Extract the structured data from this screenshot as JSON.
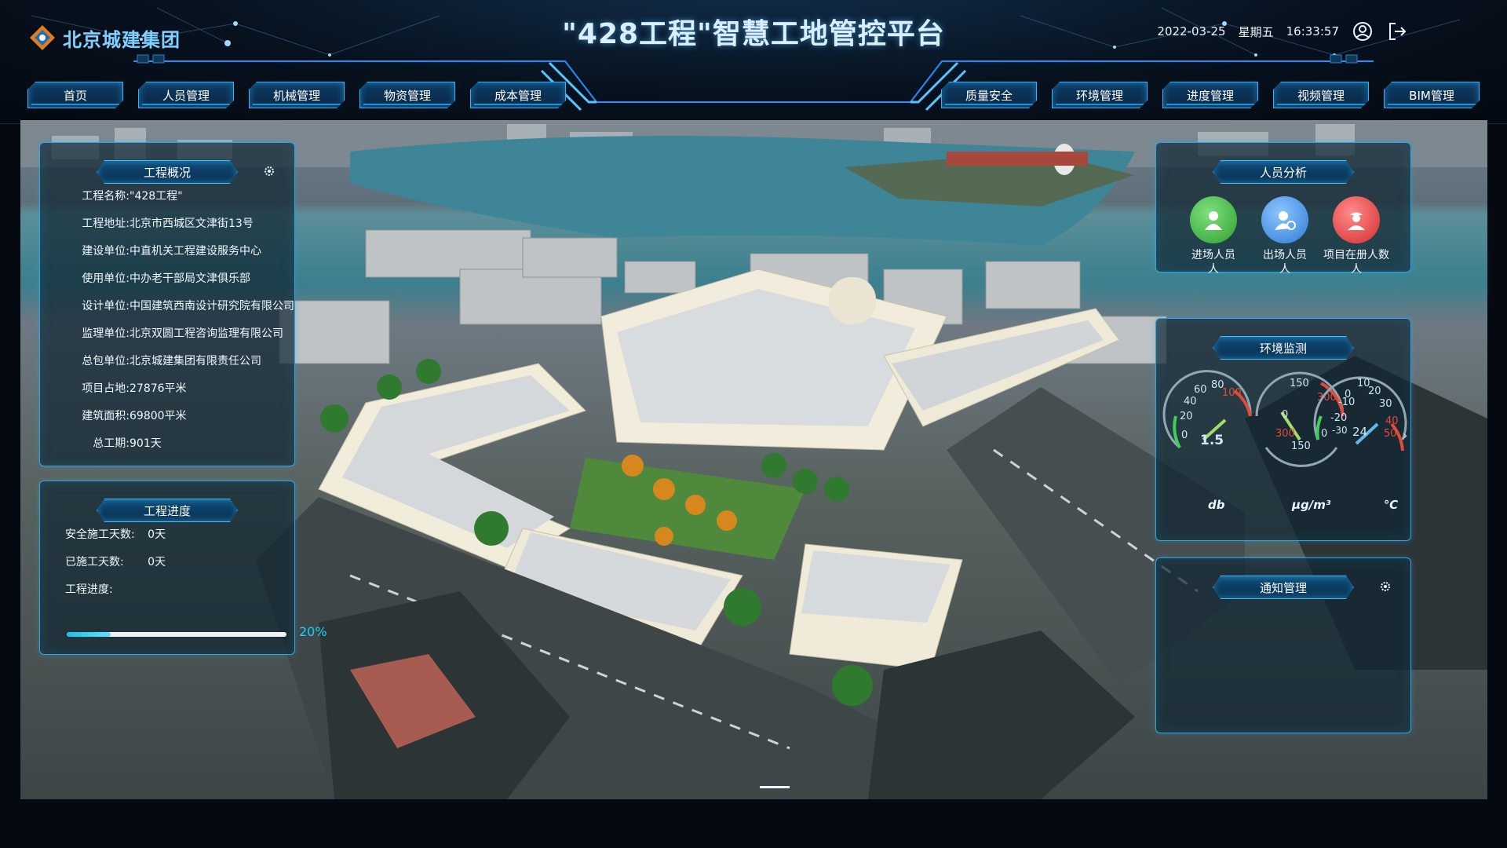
{
  "header": {
    "logo_text": "北京城建集团",
    "title": "\"428工程\"智慧工地管控平台",
    "date": "2022-03-25",
    "weekday": "星期五",
    "time": "16:33:57"
  },
  "nav": {
    "items": [
      "首页",
      "人员管理",
      "机械管理",
      "物资管理",
      "成本管理",
      "质量安全",
      "环境管理",
      "进度管理",
      "视频管理",
      "BIM管理"
    ]
  },
  "overview": {
    "title": "工程概况",
    "rows": [
      {
        "label": "工程名称:",
        "value": "\"428工程\""
      },
      {
        "label": "工程地址:",
        "value": "北京市西城区文津街13号"
      },
      {
        "label": "建设单位:",
        "value": "中直机关工程建设服务中心"
      },
      {
        "label": "使用单位:",
        "value": "中办老干部局文津俱乐部"
      },
      {
        "label": "设计单位:",
        "value": "中国建筑西南设计研究院有限公司"
      },
      {
        "label": "监理单位:",
        "value": "北京双圆工程咨询监理有限公司"
      },
      {
        "label": "总包单位:",
        "value": "北京城建集团有限责任公司"
      },
      {
        "label": "项目占地:",
        "value": "27876平米"
      },
      {
        "label": "建筑面积:",
        "value": "69800平米"
      },
      {
        "label": "总工期:",
        "value": "901天"
      }
    ]
  },
  "progress": {
    "title": "工程进度",
    "safe_days_label": "安全施工天数:",
    "safe_days_value": "0天",
    "done_days_label": "已施工天数:",
    "done_days_value": "0天",
    "progress_label": "工程进度:",
    "percent_text": "20%",
    "percent": 0.2
  },
  "personnel": {
    "title": "人员分析",
    "items": [
      {
        "label": "进场人员",
        "unit": "人",
        "color": "#3fbf3f"
      },
      {
        "label": "出场人员",
        "unit": "人",
        "color": "#3a8fe6"
      },
      {
        "label": "项目在册人数",
        "unit": "人",
        "color": "#e23b3b"
      }
    ]
  },
  "environment": {
    "title": "环境监测",
    "noise": {
      "value_text": "1.5",
      "unit": "db",
      "ticks": [
        "20",
        "40",
        "60",
        "80",
        "100"
      ],
      "zero": "0"
    },
    "pm": {
      "unit": "μg/m³",
      "ticks": [
        "0",
        "150",
        "300"
      ],
      "inner_ticks": [
        "300",
        "150",
        "0"
      ]
    },
    "temp": {
      "value_text": "24",
      "unit": "℃",
      "ticks": [
        "-30",
        "-20",
        "-10",
        "0",
        "10",
        "20",
        "30",
        "40",
        "50"
      ]
    }
  },
  "notice": {
    "title": "通知管理"
  },
  "colors": {
    "accent": "#2fb4ff",
    "progress": "#13c4e8",
    "gauge_red": "#e24a3b",
    "gauge_green": "#3ecf5a"
  }
}
